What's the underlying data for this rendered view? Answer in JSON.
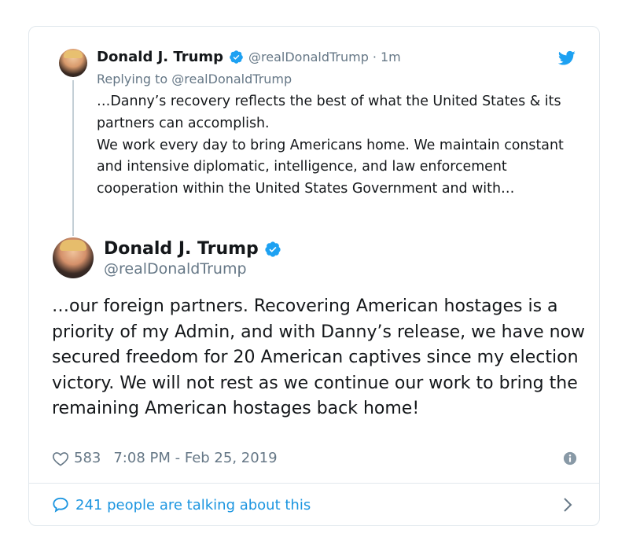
{
  "parent_tweet": {
    "name": "Donald J. Trump",
    "handle": "@realDonaldTrump",
    "separator": "·",
    "time": "1m",
    "replying_prefix": "Replying to",
    "replying_to": "@realDonaldTrump",
    "text_lines": [
      "…Danny’s recovery reflects the best of what the United States & its partners can accomplish.",
      "We work every day to bring Americans home. We maintain constant and intensive diplomatic, intelligence, and law enforcement cooperation within the United States Government and with…"
    ]
  },
  "main_tweet": {
    "name": "Donald J. Trump",
    "handle": "@realDonaldTrump",
    "text": "…our foreign partners. Recovering American hostages is a priority of my Admin, and with Danny’s release, we have now secured freedom for 20 American captives since my election victory. We will not rest as we continue our work to bring the remaining American hostages back home!",
    "likes": "583",
    "timestamp": "7:08 PM - Feb 25, 2019"
  },
  "footer": {
    "talking_label": "241 people are talking about this"
  },
  "icons": {
    "verified": "verified-badge-icon",
    "bird": "twitter-bird-icon",
    "heart": "heart-icon",
    "info": "info-icon",
    "bubble": "speech-bubble-icon",
    "chevron": "chevron-right-icon"
  },
  "colors": {
    "accent": "#1da1f2",
    "link": "#1b95e0",
    "muted": "#657786",
    "text": "#14171a",
    "border": "#e1e8ed"
  }
}
